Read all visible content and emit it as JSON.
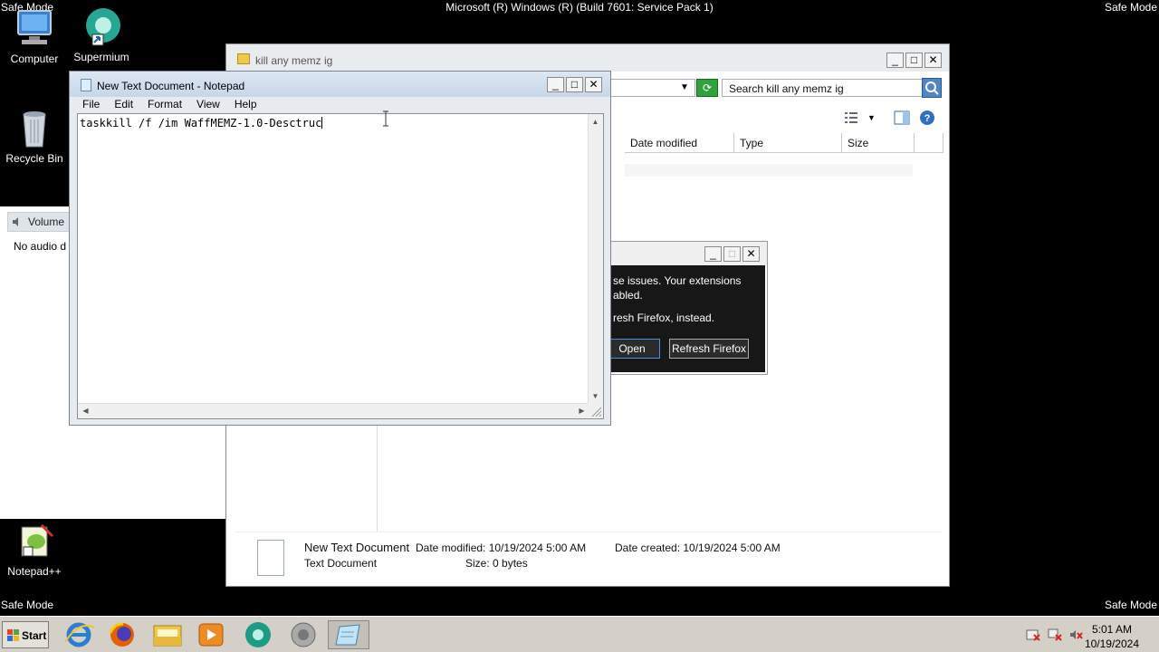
{
  "os": {
    "title": "Microsoft (R) Windows (R) (Build 7601: Service Pack 1)",
    "safe_mode_label": "Safe Mode"
  },
  "desktop_icons": [
    {
      "label": "Computer",
      "icon": "computer-icon"
    },
    {
      "label": "Supermium",
      "icon": "supermium-icon"
    },
    {
      "label": "Recycle Bin",
      "icon": "recycle-bin-icon"
    },
    {
      "label": "Notepad++",
      "icon": "notepad-plus-plus-icon"
    }
  ],
  "volume_panel": {
    "title": "Volume",
    "message": "No audio d"
  },
  "explorer": {
    "title": "kill any memz ig",
    "search_placeholder": "Search kill any memz ig",
    "columns": [
      "Date modified",
      "Type",
      "Size"
    ],
    "details": {
      "name": "New Text Document",
      "type": "Text Document",
      "date_modified": "Date modified: 10/19/2024 5:00 AM",
      "size": "Size: 0 bytes",
      "date_created": "Date created: 10/19/2024 5:00 AM"
    }
  },
  "firefox_dialog": {
    "line1": "se issues. Your extensions",
    "line2": "abled.",
    "line3": "resh Firefox, instead.",
    "open_button": "Open",
    "refresh_button": "Refresh Firefox"
  },
  "notepad": {
    "title": "New Text Document - Notepad",
    "menu": [
      "File",
      "Edit",
      "Format",
      "View",
      "Help"
    ],
    "content": "taskkill /f /im WaffMEMZ-1.0-Desctruc"
  },
  "taskbar": {
    "start_label": "Start",
    "items": [
      "internet-explorer-icon",
      "firefox-icon",
      "explorer-folder-icon",
      "media-player-icon",
      "supermium-icon",
      "speaker-icon",
      "notepad-icon"
    ],
    "clock_time": "5:01 AM",
    "clock_date": "10/19/2024"
  },
  "colors": {
    "desktop_bg": "#000000",
    "firefox_dialog_bg": "#171717",
    "refresh_green": "#2fa33a"
  }
}
